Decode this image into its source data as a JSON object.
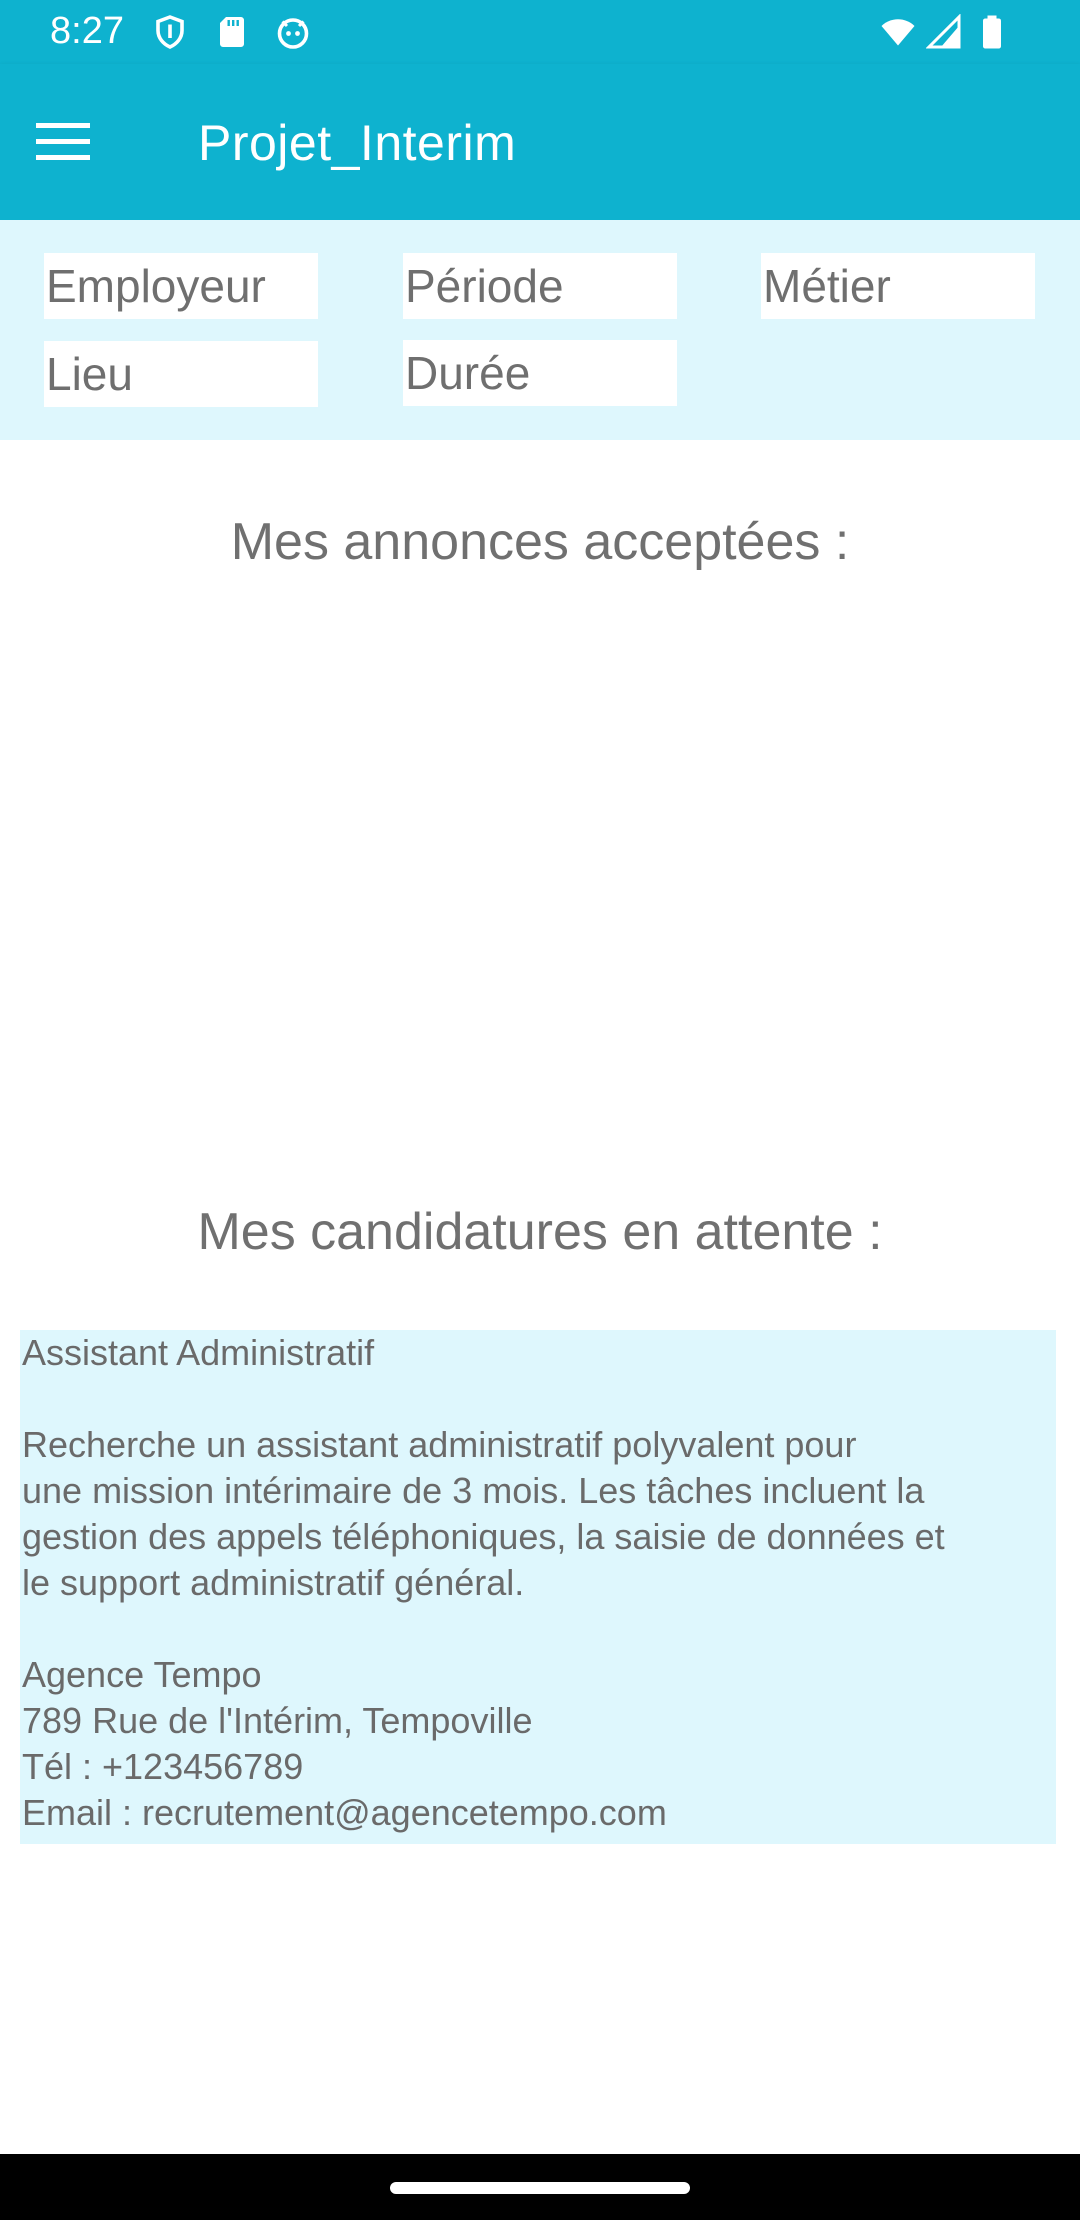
{
  "status_bar": {
    "time": "8:27",
    "left_icons": [
      "shield-icon",
      "sd-card-icon",
      "android-face-icon"
    ],
    "right_icons": [
      "wifi-icon",
      "cell-signal-icon",
      "battery-icon"
    ]
  },
  "app_bar": {
    "title": "Projet_Interim",
    "menu_icon": "hamburger-menu-icon"
  },
  "filters": {
    "employeur": "Employeur",
    "periode": "Période",
    "metier": "Métier",
    "lieu": "Lieu",
    "duree": "Durée"
  },
  "sections": {
    "accepted_title": "Mes annonces acceptées :",
    "pending_title": "Mes candidatures en attente :"
  },
  "pending_applications": [
    {
      "title": "Assistant Administratif",
      "description_lines": [
        "Recherche un assistant administratif polyvalent pour",
        "une mission intérimaire de 3 mois. Les tâches incluent la",
        "gestion des appels téléphoniques, la saisie de données et",
        "le support administratif général."
      ],
      "agency": "Agence Tempo",
      "address": "789 Rue de l'Intérim, Tempoville",
      "phone": "Tél : +123456789",
      "email": "Email : recrutement@agencetempo.com"
    }
  ],
  "colors": {
    "primary": "#0eb2cf",
    "filter_background": "#def7fd",
    "text_gray": "#707070"
  }
}
